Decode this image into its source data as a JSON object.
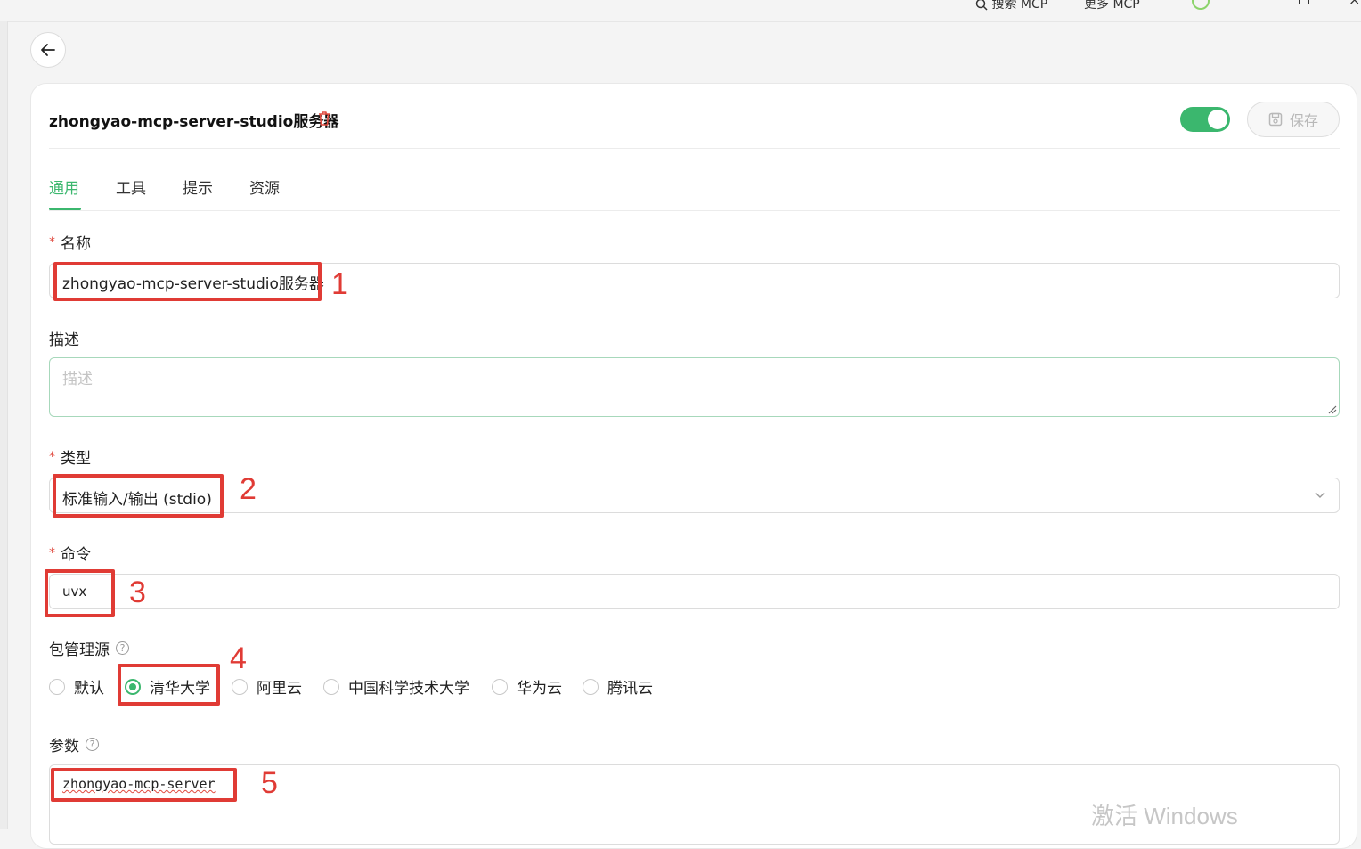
{
  "topbar": {
    "search_mcp": "搜索 MCP",
    "more_mcp": "更多 MCP"
  },
  "server": {
    "title": "zhongyao-mcp-server-studio服务器",
    "save_label": "保存",
    "enabled": true
  },
  "tabs": [
    {
      "label": "通用",
      "active": true
    },
    {
      "label": "工具",
      "active": false
    },
    {
      "label": "提示",
      "active": false
    },
    {
      "label": "资源",
      "active": false
    }
  ],
  "form": {
    "name": {
      "label": "名称",
      "required": "*",
      "value": "zhongyao-mcp-server-studio服务器"
    },
    "description": {
      "label": "描述",
      "placeholder": "描述"
    },
    "type": {
      "label": "类型",
      "required": "*",
      "value": "标准输入/输出 (stdio)"
    },
    "command": {
      "label": "命令",
      "required": "*",
      "value": "uvx"
    },
    "registry": {
      "label": "包管理源",
      "help": "?",
      "options": [
        "默认",
        "清华大学",
        "阿里云",
        "中国科学技术大学",
        "华为云",
        "腾讯云"
      ],
      "selected": "清华大学"
    },
    "args": {
      "label": "参数",
      "help": "?",
      "value": "zhongyao-mcp-server"
    }
  },
  "annotations": [
    "1",
    "2",
    "3",
    "4",
    "5"
  ],
  "watermark": "激活 Windows",
  "colors": {
    "accent": "#3bb76e",
    "annotation_red": "#e03b35",
    "required_red": "#e04a3f"
  }
}
